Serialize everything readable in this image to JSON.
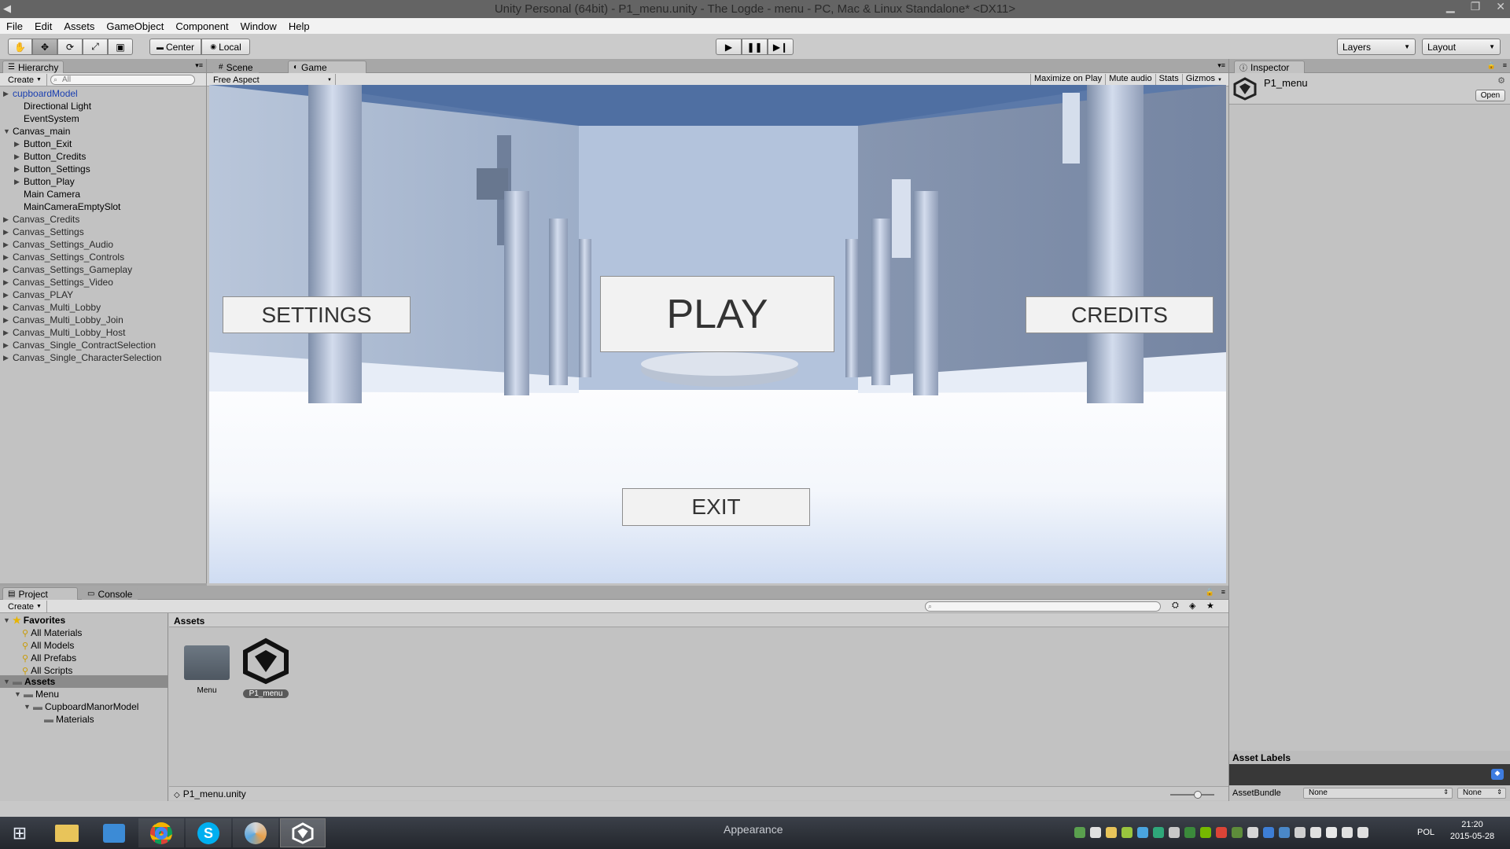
{
  "window": {
    "title": "Unity Personal (64bit) - P1_menu.unity - The Logde - menu - PC, Mac & Linux Standalone* <DX11>"
  },
  "menu": [
    "File",
    "Edit",
    "Assets",
    "GameObject",
    "Component",
    "Window",
    "Help"
  ],
  "toolbar": {
    "pivot": "Center",
    "space": "Local",
    "layers": "Layers",
    "layout": "Layout"
  },
  "hierarchy": {
    "tab": "Hierarchy",
    "create": "Create",
    "search_placeholder": "All",
    "items": [
      "cupboardModel",
      "Directional Light",
      "EventSystem",
      "Canvas_main",
      "Button_Exit",
      "Button_Credits",
      "Button_Settings",
      "Button_Play",
      "Main Camera",
      "MainCameraEmptySlot",
      "Canvas_Credits",
      "Canvas_Settings",
      "Canvas_Settings_Audio",
      "Canvas_Settings_Controls",
      "Canvas_Settings_Gameplay",
      "Canvas_Settings_Video",
      "Canvas_PLAY",
      "Canvas_Multi_Lobby",
      "Canvas_Multi_Lobby_Join",
      "Canvas_Multi_Lobby_Host",
      "Canvas_Single_ContractSelection",
      "Canvas_Single_CharacterSelection"
    ]
  },
  "game": {
    "tab_scene": "Scene",
    "tab_game": "Game",
    "aspect": "Free Aspect",
    "maximize": "Maximize on Play",
    "mute": "Mute audio",
    "stats": "Stats",
    "gizmos": "Gizmos",
    "buttons": {
      "settings": "SETTINGS",
      "play": "PLAY",
      "credits": "CREDITS",
      "exit": "EXIT"
    }
  },
  "inspector": {
    "tab": "Inspector",
    "object": "P1_menu",
    "open": "Open",
    "asset_labels": "Asset Labels",
    "assetbundle": "AssetBundle",
    "bundle_none": "None",
    "bundle_variant": "None"
  },
  "project": {
    "tab_project": "Project",
    "tab_console": "Console",
    "create": "Create",
    "favorites_label": "Favorites",
    "favorites": [
      "All Materials",
      "All Models",
      "All Prefabs",
      "All Scripts"
    ],
    "assets_label": "Assets",
    "tree": [
      "Menu",
      "CupboardManorModel",
      "Materials"
    ],
    "header": "Assets",
    "items": [
      "Menu",
      "P1_menu"
    ],
    "path": "P1_menu.unity"
  },
  "taskbar": {
    "desktop_label": "Appearance",
    "lang": "POL",
    "time": "21:20",
    "date": "2015-05-28"
  },
  "colors": {
    "selection": "#3e7ce0",
    "panel": "#c2c2c2",
    "sky": "#5b79a9"
  }
}
